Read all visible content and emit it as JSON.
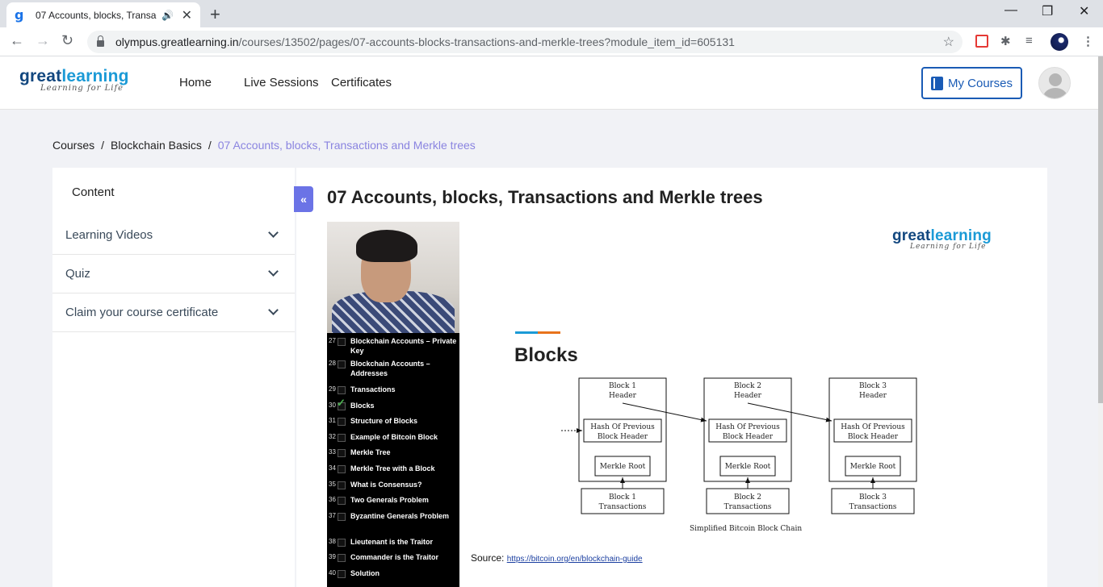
{
  "browser": {
    "tab_title": "07 Accounts, blocks, Transacti",
    "url_domain": "olympus.greatlearning.in",
    "url_path": "/courses/13502/pages/07-accounts-blocks-transactions-and-merkle-trees?module_item_id=605131"
  },
  "site": {
    "logo_great": "great",
    "logo_learning": "learning",
    "logo_tagline": "Learning for Life",
    "nav": [
      "Home",
      "Live Sessions",
      "Certificates"
    ],
    "my_courses": "My Courses"
  },
  "breadcrumb": {
    "items": [
      "Courses",
      "Blockchain Basics"
    ],
    "current": "07 Accounts, blocks, Transactions and Merkle trees",
    "separator": "/"
  },
  "sidebar": {
    "title": "Content",
    "sections": [
      "Learning Videos",
      "Quiz",
      "Claim your course certificate"
    ],
    "collapse_icon": "«"
  },
  "main": {
    "title": "07 Accounts, blocks, Transactions and Merkle trees"
  },
  "video": {
    "toc": [
      {
        "num": "27",
        "label": "Blockchain Accounts – Private Key",
        "checked": false
      },
      {
        "num": "28",
        "label": "Blockchain Accounts – Addresses",
        "checked": false
      },
      {
        "num": "29",
        "label": "Transactions",
        "checked": false
      },
      {
        "num": "30",
        "label": "Blocks",
        "checked": true
      },
      {
        "num": "31",
        "label": "Structure of Blocks",
        "checked": false
      },
      {
        "num": "32",
        "label": "Example of Bitcoin Block",
        "checked": false
      },
      {
        "num": "33",
        "label": "Merkle Tree",
        "checked": false
      },
      {
        "num": "34",
        "label": "Merkle Tree with a Block",
        "checked": false
      },
      {
        "num": "35",
        "label": "What is Consensus?",
        "checked": false
      },
      {
        "num": "36",
        "label": "Two Generals Problem",
        "checked": false
      },
      {
        "num": "37",
        "label": "Byzantine Generals Problem",
        "checked": false
      },
      {
        "num": "38",
        "label": "Lieutenant is the Traitor",
        "checked": false
      },
      {
        "num": "39",
        "label": "Commander is the Traitor",
        "checked": false
      },
      {
        "num": "40",
        "label": "Solution",
        "checked": false
      }
    ],
    "slide_heading": "Blocks",
    "blocks": [
      {
        "header": [
          "Block 1",
          "Header"
        ],
        "hash": [
          "Hash Of Previous",
          "Block Header"
        ],
        "merkle": "Merkle Root",
        "tx": [
          "Block 1",
          "Transactions"
        ]
      },
      {
        "header": [
          "Block 2",
          "Header"
        ],
        "hash": [
          "Hash Of Previous",
          "Block Header"
        ],
        "merkle": "Merkle Root",
        "tx": [
          "Block 2",
          "Transactions"
        ]
      },
      {
        "header": [
          "Block 3",
          "Header"
        ],
        "hash": [
          "Hash Of Previous",
          "Block Header"
        ],
        "merkle": "Merkle Root",
        "tx": [
          "Block 3",
          "Transactions"
        ]
      }
    ],
    "diagram_caption": "Simplified Bitcoin Block Chain",
    "source_label": "Source:",
    "source_link": "https://bitcoin.org/en/blockchain-guide"
  }
}
